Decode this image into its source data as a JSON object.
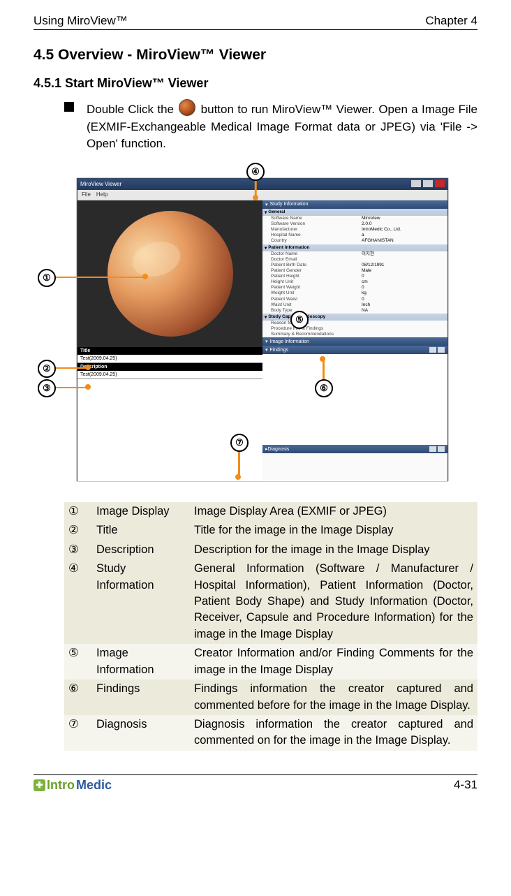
{
  "header": {
    "left": "Using MiroView™",
    "right": "Chapter 4"
  },
  "section": {
    "title": "4.5 Overview - MiroView™ Viewer",
    "sub": "4.5.1    Start MiroView™ Viewer"
  },
  "bullet": {
    "pre": "Double Click the ",
    "post": " button to run MiroView™ Viewer. Open a Image File (EXMIF-Exchangeable Medical Image Format data or JPEG) via 'File -> Open' function."
  },
  "callouts": {
    "c1": "①",
    "c2": "②",
    "c3": "③",
    "c4": "④",
    "c5": "⑤",
    "c6": "⑥",
    "c7": "⑦"
  },
  "app": {
    "title": "MiroView Viewer",
    "menu": {
      "file": "File",
      "help": "Help"
    },
    "left": {
      "title_label": "Title",
      "title_value": "Test(2009.04.25)",
      "desc_label": "Description",
      "desc_value": "Test(2009.04.25)"
    },
    "right": {
      "study_header": "Study Information",
      "general": {
        "heading": "General",
        "rows": {
          "sw_name_k": "Software Name",
          "sw_name_v": "MiroView",
          "sw_ver_k": "Software Version",
          "sw_ver_v": "2.0.0",
          "mfr_k": "Manufacturer",
          "mfr_v": "IntroMedic Co., Ltd.",
          "hosp_k": "Hospital Name",
          "hosp_v": "a",
          "country_k": "Country",
          "country_v": "AFGHANISTAN"
        }
      },
      "patient": {
        "heading": "Patient Information",
        "rows": {
          "name_k": "Doctor Name",
          "name_v": "이지현",
          "email_k": "Doctor Email",
          "email_v": "",
          "birth_k": "Patient Birth Date",
          "birth_v": "08/12/1991",
          "gender_k": "Patient Gender",
          "gender_v": "Male",
          "height_k": "Patient Height",
          "height_v": "0",
          "hunit_k": "Height Unit",
          "hunit_v": "cm",
          "weight_k": "Patient Weight",
          "weight_v": "0",
          "wunit_k": "Weight Unit",
          "wunit_v": "kg",
          "waist_k": "Patient Waist",
          "waist_v": "0",
          "waistu_k": "Waist Unit",
          "waistu_v": "Inch",
          "body_k": "Body Type",
          "body_v": "NA"
        }
      },
      "study_ce": {
        "heading": "Study Capsule Endoscopy",
        "rows": {
          "reason_k": "Reason for referral",
          "reason_v": "",
          "proc_k": "Procedure Info & Findings",
          "proc_v": "",
          "summ_k": "Summary & Recommendations",
          "summ_v": ""
        }
      },
      "image_info": "Image Information",
      "findings": "Findings",
      "diagnosis": "Diagnosis"
    }
  },
  "legend": {
    "r1_n": "①",
    "r1_l": "Image Display",
    "r1_d": "Image Display Area (EXMIF or JPEG)",
    "r2_n": "②",
    "r2_l": "Title",
    "r2_d": "Title for the image in the Image Display",
    "r3_n": "③",
    "r3_l": "Description",
    "r3_d": "Description for the image in the Image Display",
    "r4_n": "④",
    "r4_l": "Study Information",
    "r4_d": "General Information (Software / Manufacturer / Hospital Information), Patient Information (Doctor, Patient Body Shape) and Study Information (Doctor, Receiver, Capsule and Procedure Information) for the image in the Image Display",
    "r5_n": "⑤",
    "r5_l": "Image Information",
    "r5_d": "Creator Information and/or Finding Comments for the image in the Image Display",
    "r6_n": "⑥",
    "r6_l": "Findings",
    "r6_d": "Findings information the creator captured and commented before for the image in the Image Display.",
    "r7_n": "⑦",
    "r7_l": "Diagnosis",
    "r7_d": "Diagnosis information the creator captured and commented on for the image in the Image Display."
  },
  "footer": {
    "brand_a": "Intro",
    "brand_b": "Medic",
    "page": "4-31"
  }
}
